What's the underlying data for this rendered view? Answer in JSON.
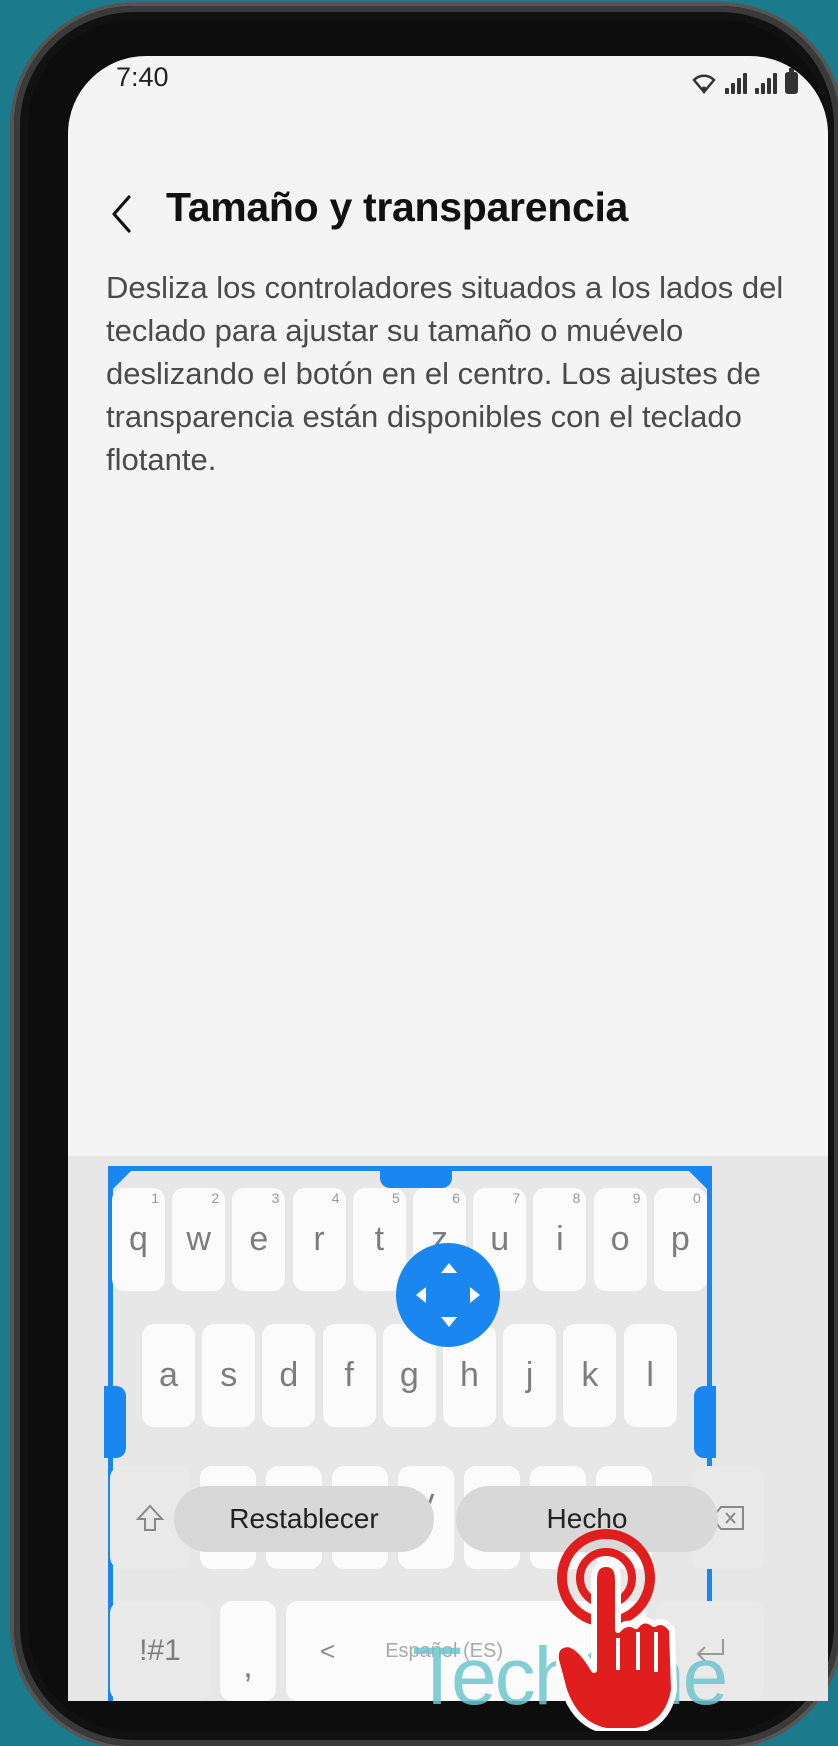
{
  "status_bar": {
    "time": "7:40",
    "icons": [
      "wifi-icon",
      "signal-icon",
      "signal-icon",
      "battery-icon"
    ]
  },
  "header": {
    "back_icon": "chevron-left-icon",
    "title": "Tamaño y transparencia"
  },
  "description": "Desliza los controladores situados a los lados del teclado para ajustar su tamaño o muévelo deslizando el botón en el centro. Los ajustes de transparencia están disponibles con el teclado flotante.",
  "keyboard": {
    "row1": [
      {
        "key": "q",
        "hint": "1"
      },
      {
        "key": "w",
        "hint": "2"
      },
      {
        "key": "e",
        "hint": "3"
      },
      {
        "key": "r",
        "hint": "4"
      },
      {
        "key": "t",
        "hint": "5"
      },
      {
        "key": "z",
        "hint": "6"
      },
      {
        "key": "u",
        "hint": "7"
      },
      {
        "key": "i",
        "hint": "8"
      },
      {
        "key": "o",
        "hint": "9"
      },
      {
        "key": "p",
        "hint": "0"
      }
    ],
    "row2": [
      "a",
      "s",
      "d",
      "f",
      "g",
      "h",
      "j",
      "k",
      "l"
    ],
    "row3_visible": "v",
    "symbols_key": "!#1",
    "comma_key": ",",
    "space_left_arrow": "<",
    "space_label": "Español (ES)",
    "reset_button": "Restablecer",
    "done_button": "Hecho"
  },
  "watermark": "TechOne",
  "colors": {
    "accent": "#1a86f0",
    "background": "#1b7a8c",
    "screen": "#f4f4f4",
    "pointer": "#e01e1e"
  }
}
